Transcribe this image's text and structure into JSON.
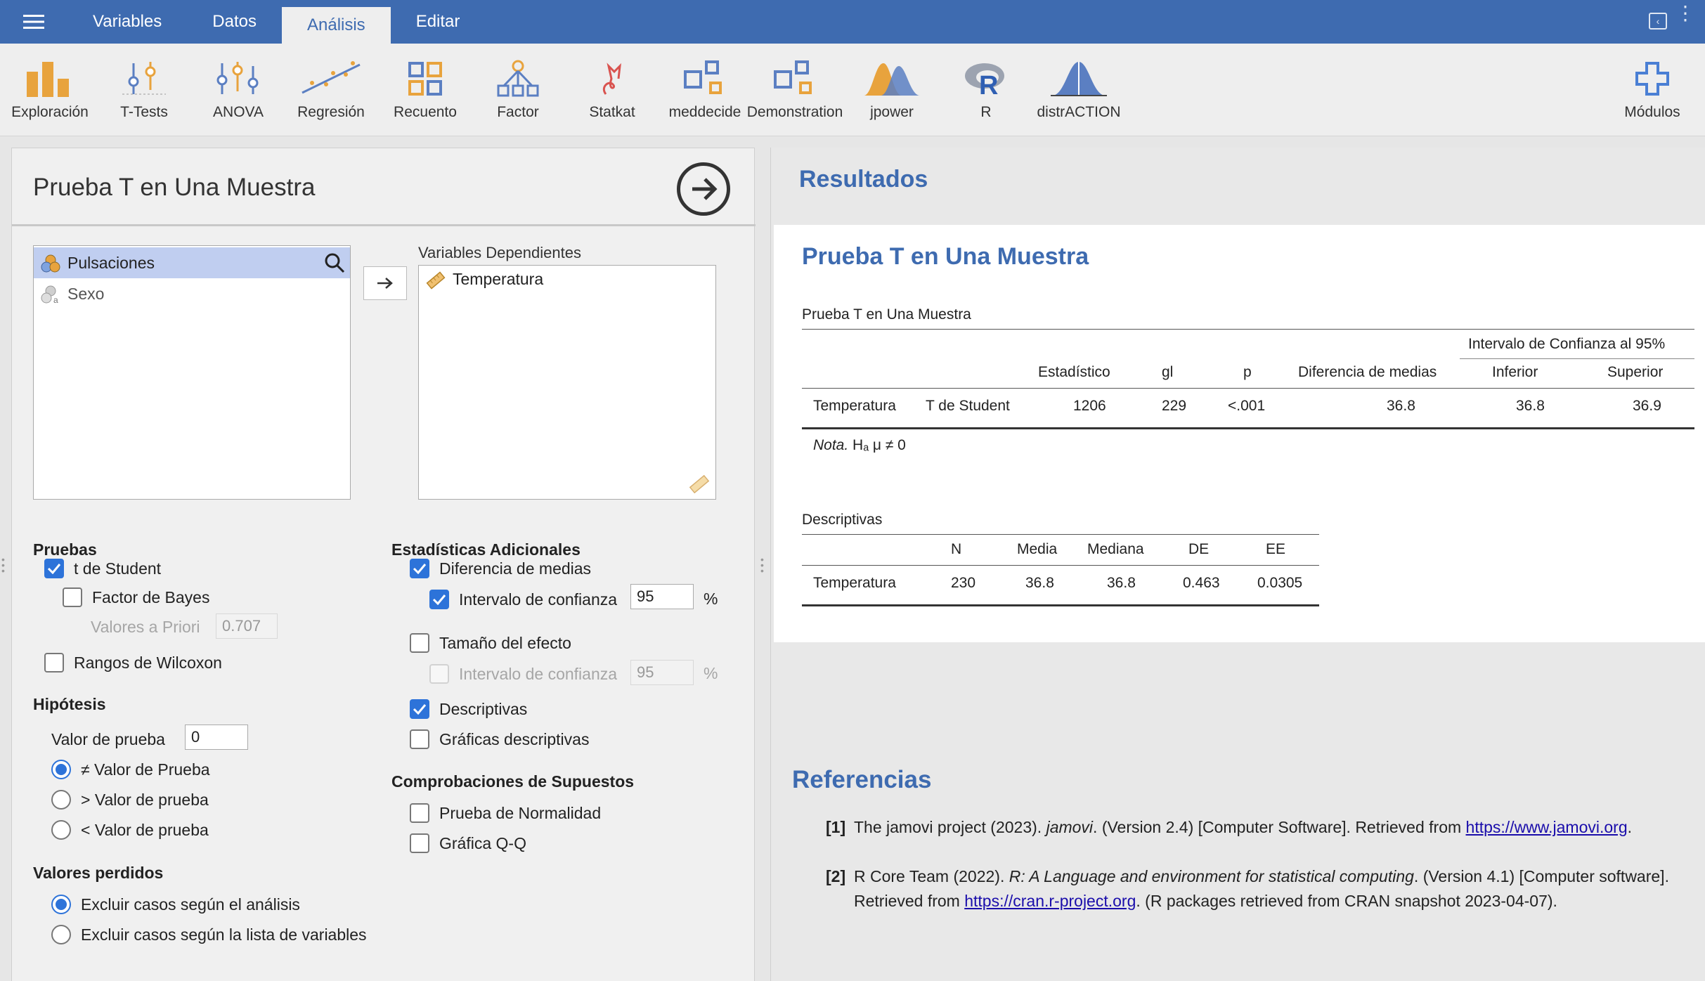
{
  "menu": {
    "tabs": [
      "Variables",
      "Datos",
      "Análisis",
      "Editar"
    ],
    "active_tab": "Análisis"
  },
  "ribbon": {
    "items": [
      "Exploración",
      "T-Tests",
      "ANOVA",
      "Regresión",
      "Recuento",
      "Factor",
      "Statkat",
      "meddecide",
      "Demonstration",
      "jpower",
      "R",
      "distrACTION"
    ],
    "modules": "Módulos"
  },
  "options": {
    "title": "Prueba T en Una Muestra",
    "variables": [
      "Pulsaciones",
      "Sexo"
    ],
    "dependent_label": "Variables Dependientes",
    "dependent_vars": [
      "Temperatura"
    ],
    "pruebas": {
      "heading": "Pruebas",
      "student": "t de Student",
      "bayes": "Factor de Bayes",
      "prior_label": "Valores a Priori",
      "prior_value": "0.707",
      "wilcoxon": "Rangos de Wilcoxon"
    },
    "hipotesis": {
      "heading": "Hipótesis",
      "test_value_label": "Valor de prueba",
      "test_value": "0",
      "ne": "≠ Valor de Prueba",
      "gt": "> Valor de prueba",
      "lt": "< Valor de prueba"
    },
    "perdidos": {
      "heading": "Valores perdidos",
      "by_analysis": "Excluir casos según el análisis",
      "listwise": "Excluir casos según la lista de variables"
    },
    "adicionales": {
      "heading": "Estadísticas Adicionales",
      "mean_diff": "Diferencia de medias",
      "ci": "Intervalo de confianza",
      "ci_value": "95",
      "pct": "%",
      "effect": "Tamaño del efecto",
      "effect_ci": "Intervalo de confianza",
      "effect_ci_value": "95",
      "descriptives": "Descriptivas",
      "desc_plots": "Gráficas descriptivas"
    },
    "supuestos": {
      "heading": "Comprobaciones de Supuestos",
      "normality": "Prueba de Normalidad",
      "qq": "Gráfica Q-Q"
    }
  },
  "results": {
    "heading": "Resultados",
    "analysis_title": "Prueba T en Una Muestra",
    "ttest": {
      "caption": "Prueba T en Una Muestra",
      "ci_header": "Intervalo de Confianza al 95%",
      "headers": [
        "Estadístico",
        "gl",
        "p",
        "Diferencia de medias",
        "Inferior",
        "Superior"
      ],
      "row": [
        "Temperatura",
        "T de Student",
        "1206",
        "229",
        "<.001",
        "36.8",
        "36.8",
        "36.9"
      ],
      "note_label": "Nota.",
      "note_text": "Hₐ μ ≠ 0"
    },
    "desc": {
      "caption": "Descriptivas",
      "headers": [
        "N",
        "Media",
        "Mediana",
        "DE",
        "EE"
      ],
      "row": [
        "Temperatura",
        "230",
        "36.8",
        "36.8",
        "0.463",
        "0.0305"
      ]
    }
  },
  "references": {
    "heading": "Referencias",
    "items": [
      {
        "num": "[1]",
        "pre": "The jamovi project (2023). ",
        "italic": "jamovi",
        "post": ". (Version 2.4) [Computer Software]. Retrieved from ",
        "link": "https://www.jamovi.org",
        "end": "."
      },
      {
        "num": "[2]",
        "pre": "R Core Team (2022). ",
        "italic": "R: A Language and environment for statistical computing",
        "post": ". (Version 4.1) [Computer software]. Retrieved from ",
        "link": "https://cran.r-project.org",
        "end": ". (R packages retrieved from CRAN snapshot 2023-04-07)."
      }
    ]
  },
  "colors": {
    "brand": "#3e6bb0",
    "checkbox": "#2d73d9",
    "selection": "#c0cef0"
  }
}
